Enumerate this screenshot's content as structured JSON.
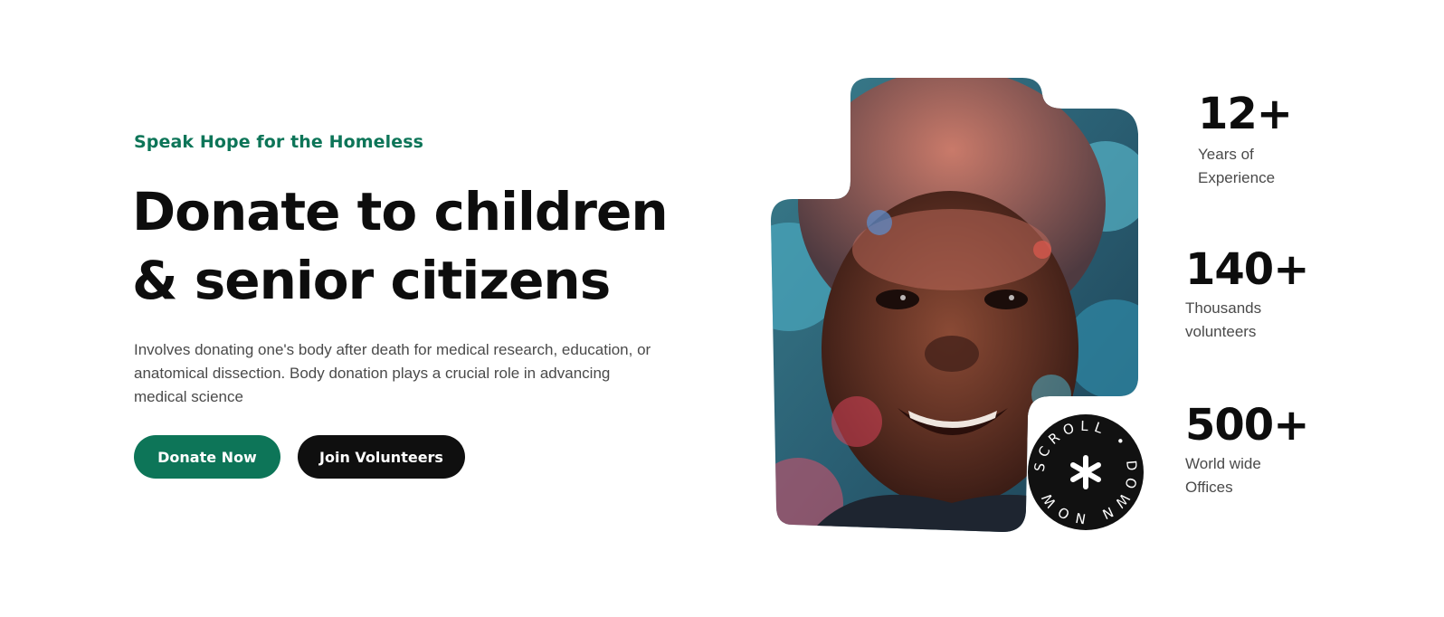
{
  "hero": {
    "eyebrow": "Speak Hope for the Homeless",
    "headline_line1": "Donate to children",
    "headline_line2": "& senior citizens",
    "description": "Involves donating one's body after death for medical research, education, or anatomical dissection. Body donation plays a crucial role in advancing medical science",
    "buttons": {
      "donate_label": "Donate Now",
      "join_label": "Join Volunteers"
    }
  },
  "photo": {
    "subject": "smiling child with colored powder on face"
  },
  "scroll_badge": {
    "ring_text": "SCROLL • DOWN NOW •",
    "icon": "asterisk-icon"
  },
  "stats": [
    {
      "value": "12+",
      "label_line1": "Years of",
      "label_line2": "Experience"
    },
    {
      "value": "140+",
      "label_line1": "Thousands",
      "label_line2": "volunteers"
    },
    {
      "value": "500+",
      "label_line1": "World wide",
      "label_line2": "Offices"
    }
  ],
  "colors": {
    "brand_green": "#0d7558",
    "dark": "#0f0f0f",
    "text_muted": "#4a4a4a"
  }
}
